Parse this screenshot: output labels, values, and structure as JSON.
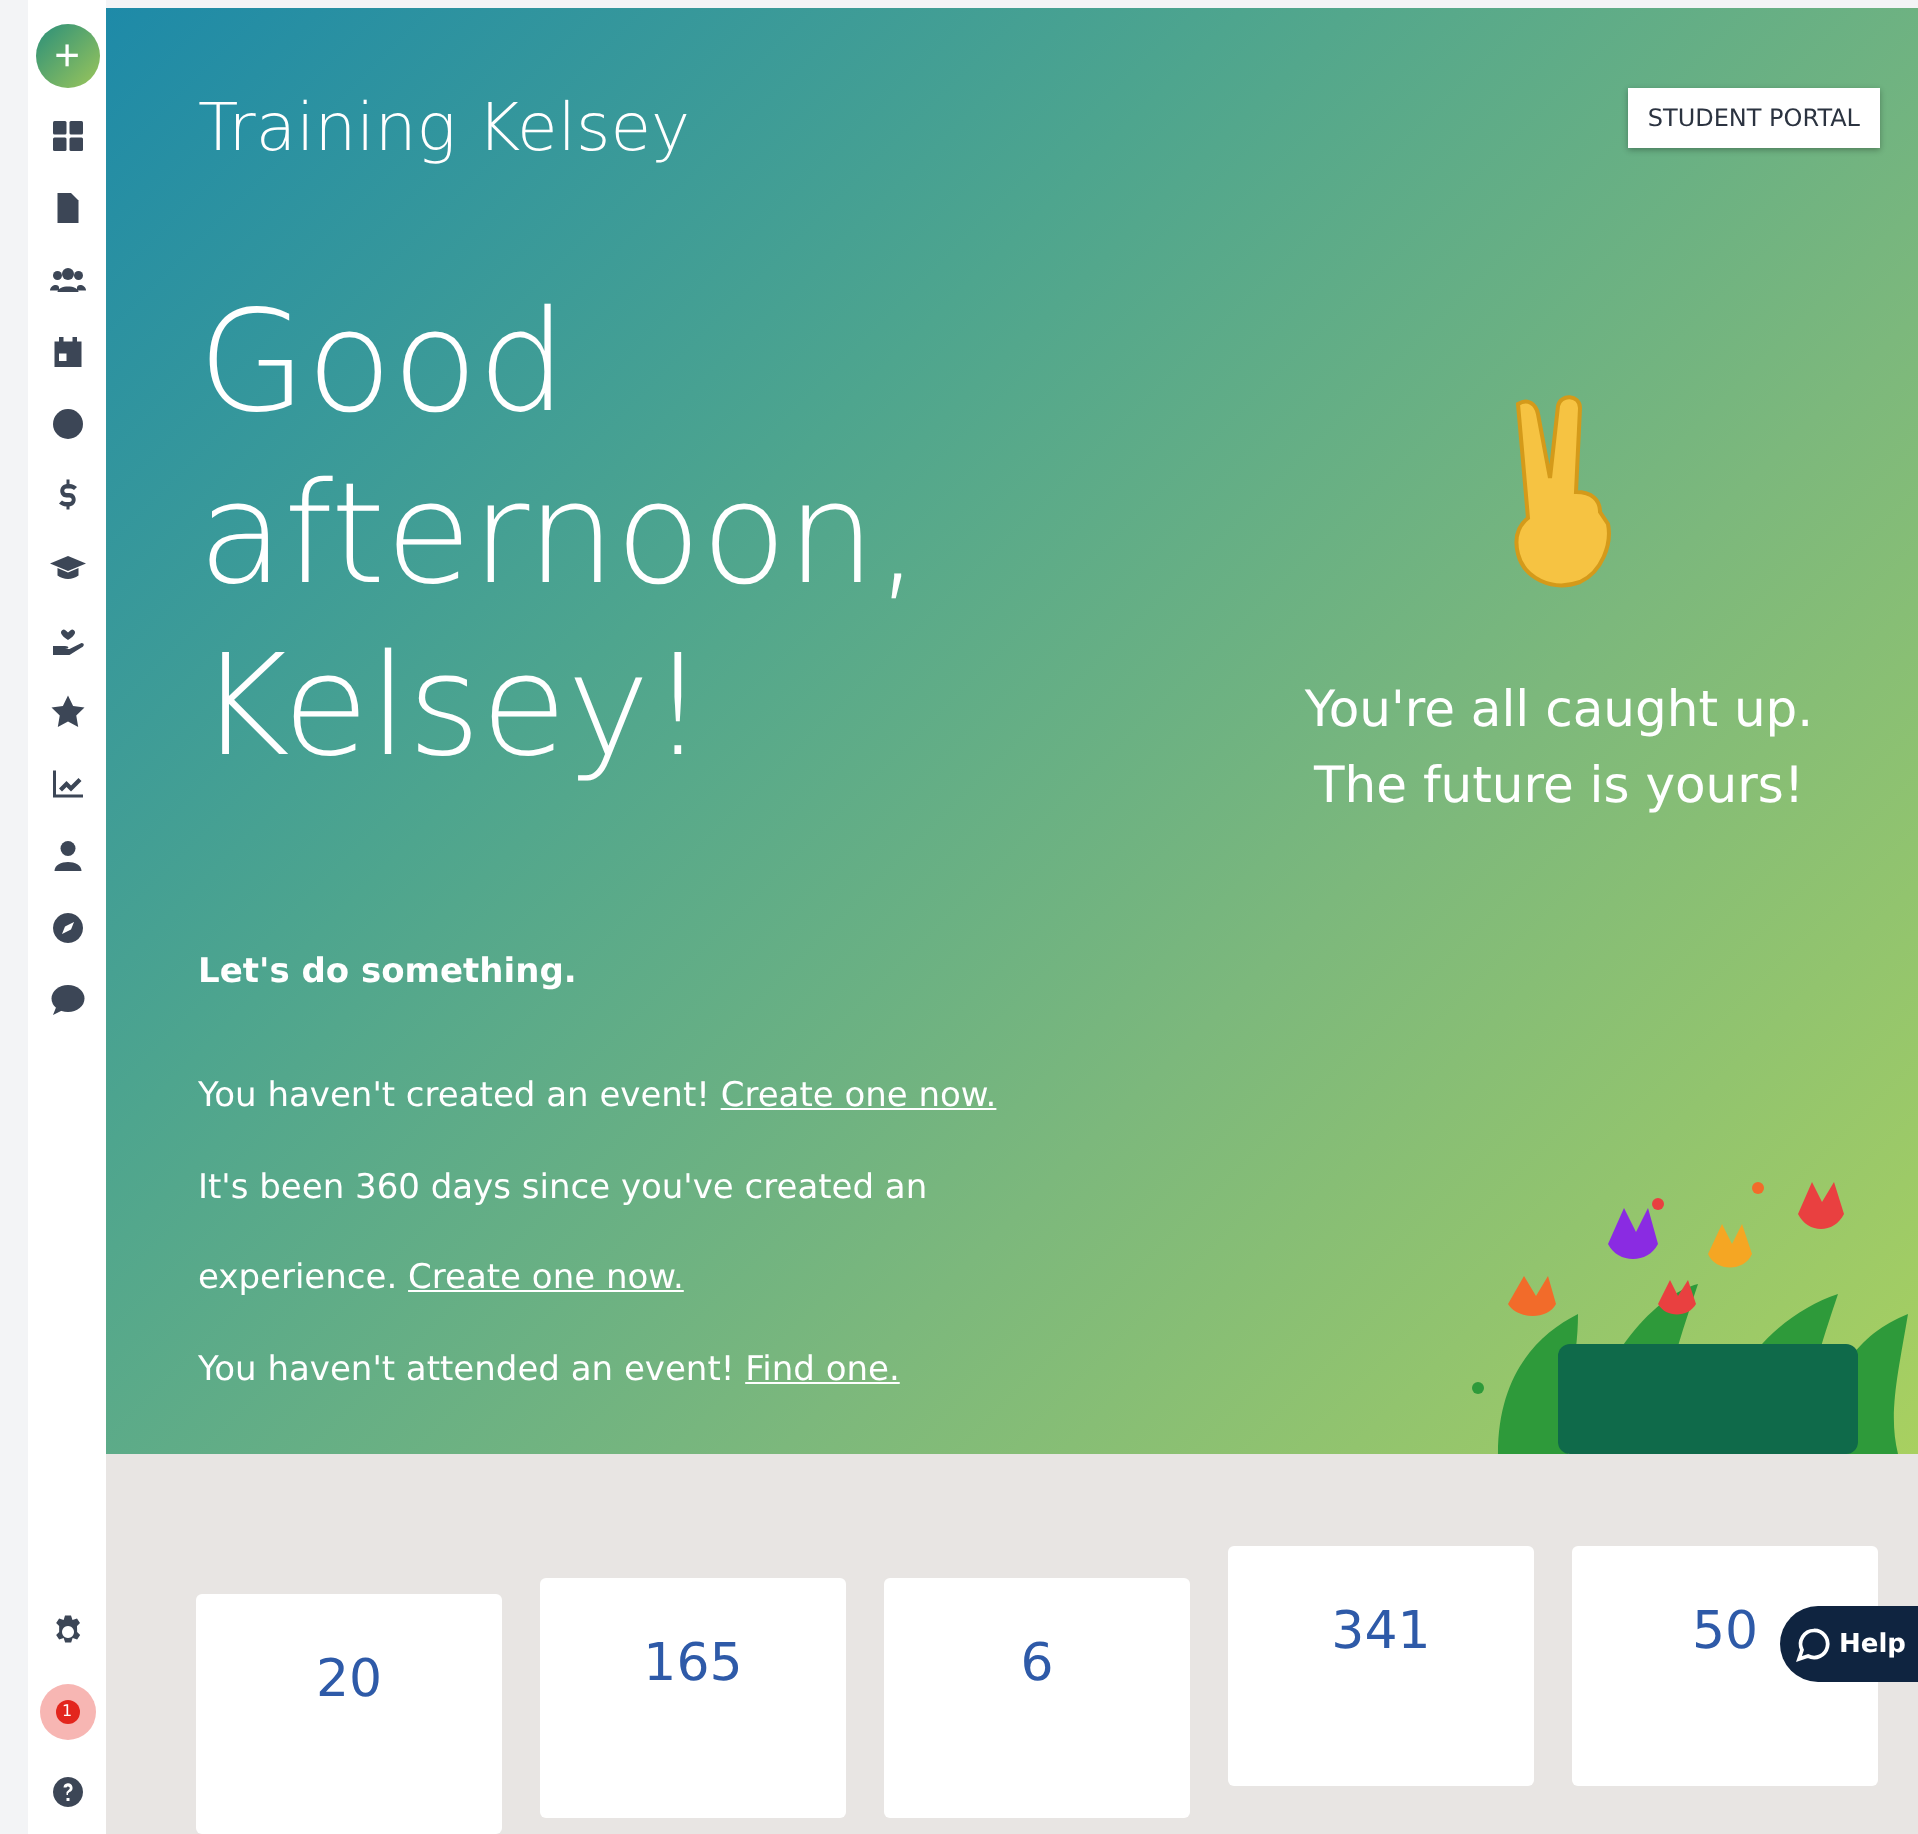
{
  "sidebar": {
    "add_button": "+",
    "notification_count": "1"
  },
  "header": {
    "title": "Training Kelsey",
    "portal_button": "STUDENT PORTAL"
  },
  "greeting": "Good afternoon, Kelsey!",
  "status": {
    "lines": [
      "You're all caught up.",
      "The future is yours!"
    ]
  },
  "prompt": "Let's do something.",
  "suggestions": [
    {
      "text": "You haven't created an event! ",
      "link": "Create one now."
    },
    {
      "text": "It's been 360 days since you've created an experience. ",
      "link": "Create one now."
    },
    {
      "text": "You haven't attended an event! ",
      "link": "Find one."
    }
  ],
  "stats": [
    {
      "value": "20"
    },
    {
      "value": "165"
    },
    {
      "value": "6"
    },
    {
      "value": "341"
    },
    {
      "value": "50"
    }
  ],
  "help_button": "Help"
}
